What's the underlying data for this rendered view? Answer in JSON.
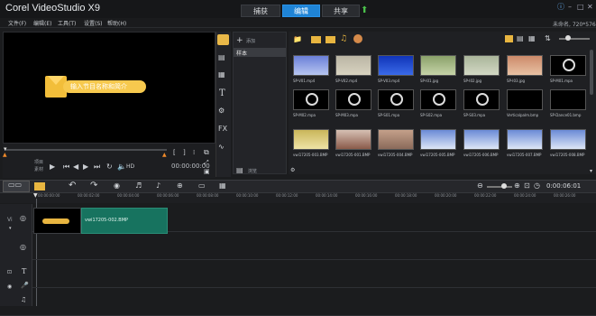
{
  "app": {
    "title": "Corel VideoStudio X9",
    "tabs": [
      {
        "label": "捕获"
      },
      {
        "label": "编辑",
        "active": true
      },
      {
        "label": "共享"
      }
    ],
    "resolution": "未命名, 720*576"
  },
  "menu": [
    "文件(F)",
    "编辑(E)",
    "工具(T)",
    "设置(S)",
    "帮助(H)"
  ],
  "preview": {
    "banner_text": "输入节目名称和简介",
    "labels": [
      "项目",
      "素材"
    ],
    "time_values": [
      "-",
      "-"
    ],
    "hd_label": "HD"
  },
  "library": {
    "add_label": "添加",
    "folder": "样本",
    "rows": [
      [
        "SP-V01.mp4",
        "SP-V02.mp4",
        "SP-V03.mp4",
        "SP-I01.jpg",
        "SP-I02.jpg",
        "SP-I03.jpg",
        "SP-M01.mpa"
      ],
      [
        "SP-M02.mpa",
        "SP-M03.mpa",
        "SP-S01.mpa",
        "SP-S02.mpa",
        "SP-S03.mpa",
        "Verticalpalm.bmp",
        "SP-Dance01.bmp"
      ],
      [
        "vwi17205-003.BMP",
        "vwi17205-001.BMP",
        "vwi17205-004.BMP",
        "vwi17205-005.BMP",
        "vwi17205-006.BMP",
        "vwi17205-007.BMP",
        "vwi17205-008.BMP"
      ]
    ],
    "browse_label": "浏览"
  },
  "timeline": {
    "timecode": "0:00:06:01",
    "ticks": [
      "00:00:00:00",
      "00:00:02:00",
      "00:00:04:00",
      "00:00:06:00",
      "00:00:08:00",
      "00:00:10:00",
      "00:00:12:00",
      "00:00:14:00",
      "00:00:16:00",
      "00:00:18:00",
      "00:00:20:00",
      "00:00:22:00",
      "00:00:24:00",
      "00:00:26:00"
    ],
    "clip_label": "vwi17205-002.BMP",
    "track_labels": [
      "Vi",
      "",
      "T",
      "",
      ""
    ]
  },
  "colors": {
    "accent": "#1f84d6",
    "clip": "#17735f",
    "folder": "#e8b540"
  }
}
